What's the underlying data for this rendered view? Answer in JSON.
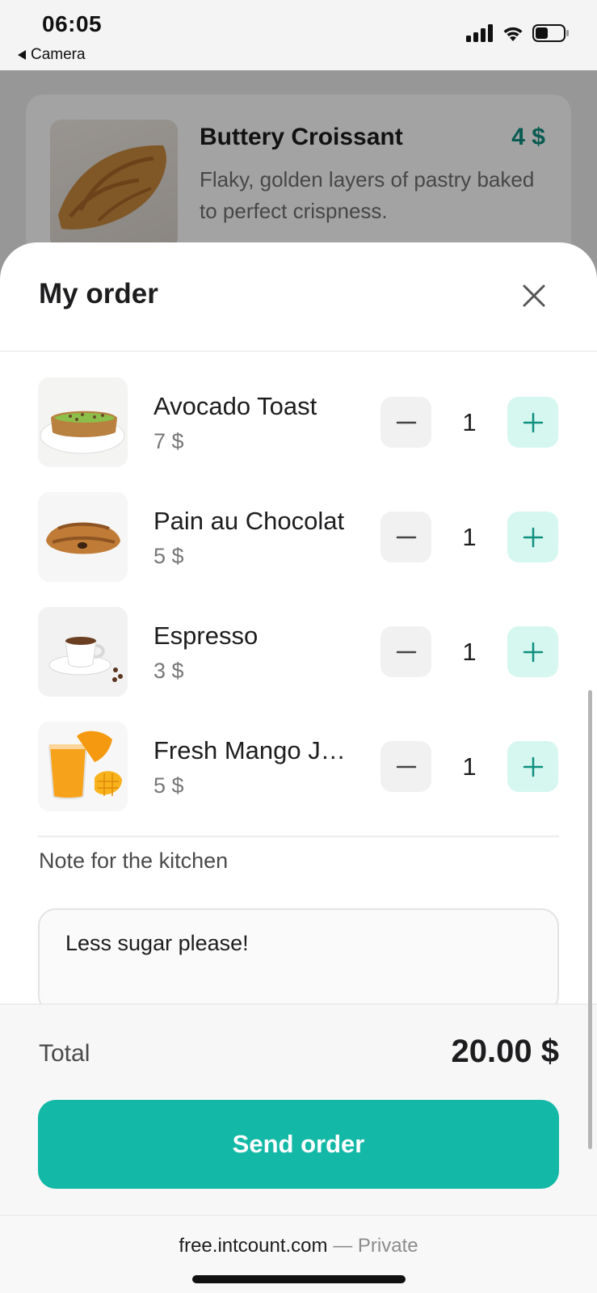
{
  "status_bar": {
    "time": "06:05",
    "back_label": "Camera",
    "icons": [
      "signal-icon",
      "wifi-icon",
      "battery-icon"
    ]
  },
  "background_card": {
    "title": "Buttery Croissant",
    "price": "4 $",
    "description": "Flaky, golden layers of pastry baked to perfect crispness.",
    "price_color": "#0f8f80"
  },
  "sheet": {
    "title": "My order",
    "close_icon": "close-icon"
  },
  "order_items": [
    {
      "name": "Avocado Toast",
      "price": "7 $",
      "quantity": "1",
      "image": "avocado-toast-photo"
    },
    {
      "name": "Pain au Chocolat",
      "price": "5 $",
      "quantity": "1",
      "image": "pain-au-chocolat-photo"
    },
    {
      "name": "Espresso",
      "price": "3 $",
      "quantity": "1",
      "image": "espresso-photo"
    },
    {
      "name": "Fresh Mango Juice",
      "price": "5 $",
      "quantity": "1",
      "image": "mango-juice-photo"
    }
  ],
  "note": {
    "label": "Note for the kitchen",
    "value": "Less sugar please!"
  },
  "footer": {
    "total_label": "Total",
    "total_value": "20.00 $",
    "send_label": "Send order"
  },
  "browser": {
    "domain": "free.intcount.com",
    "separator": "—",
    "mode": "Private"
  },
  "colors": {
    "accent": "#14b8a6",
    "plus_bg": "#d6f7f0",
    "minus_bg": "#f1f1f1"
  }
}
